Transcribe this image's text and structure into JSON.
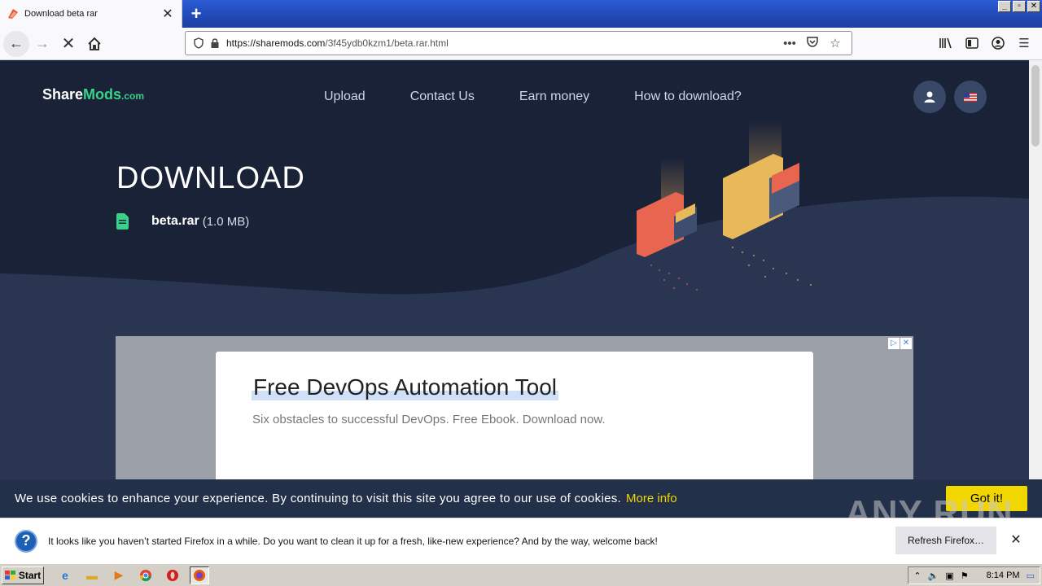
{
  "browser": {
    "tab_title": "Download beta rar",
    "url_domain": "https://sharemods.com",
    "url_path": "/3f45ydb0kzm1/beta.rar.html",
    "win_min": "_",
    "win_max": "▫",
    "win_close": "✕"
  },
  "site": {
    "logo_share": "Share",
    "logo_mods": "Mods",
    "logo_com": ".com",
    "menu": [
      "Upload",
      "Contact Us",
      "Earn money",
      "How to download?"
    ],
    "heading": "DOWNLOAD",
    "file_name": "beta.rar",
    "file_size": "(1.0 MB)"
  },
  "ad": {
    "title": "Free DevOps Automation Tool",
    "subtitle": "Six obstacles to successful DevOps. Free Ebook. Download now."
  },
  "cookie": {
    "text": "We use cookies to enhance your experience. By continuing to visit this site you agree to our use of cookies.",
    "more_info": "More info",
    "button": "Got it!"
  },
  "notification": {
    "text": "It looks like you haven’t started Firefox in a while. Do you want to clean it up for a fresh, like-new experience? And by the way, welcome back!",
    "refresh_button": "Refresh Firefox…"
  },
  "watermark": "ANY RUN",
  "taskbar": {
    "start": "Start",
    "clock": "8:14 PM"
  },
  "colors": {
    "accent_green": "#3ad18a",
    "cookie_yellow": "#f1d600",
    "hero_dark": "#1a2238"
  }
}
